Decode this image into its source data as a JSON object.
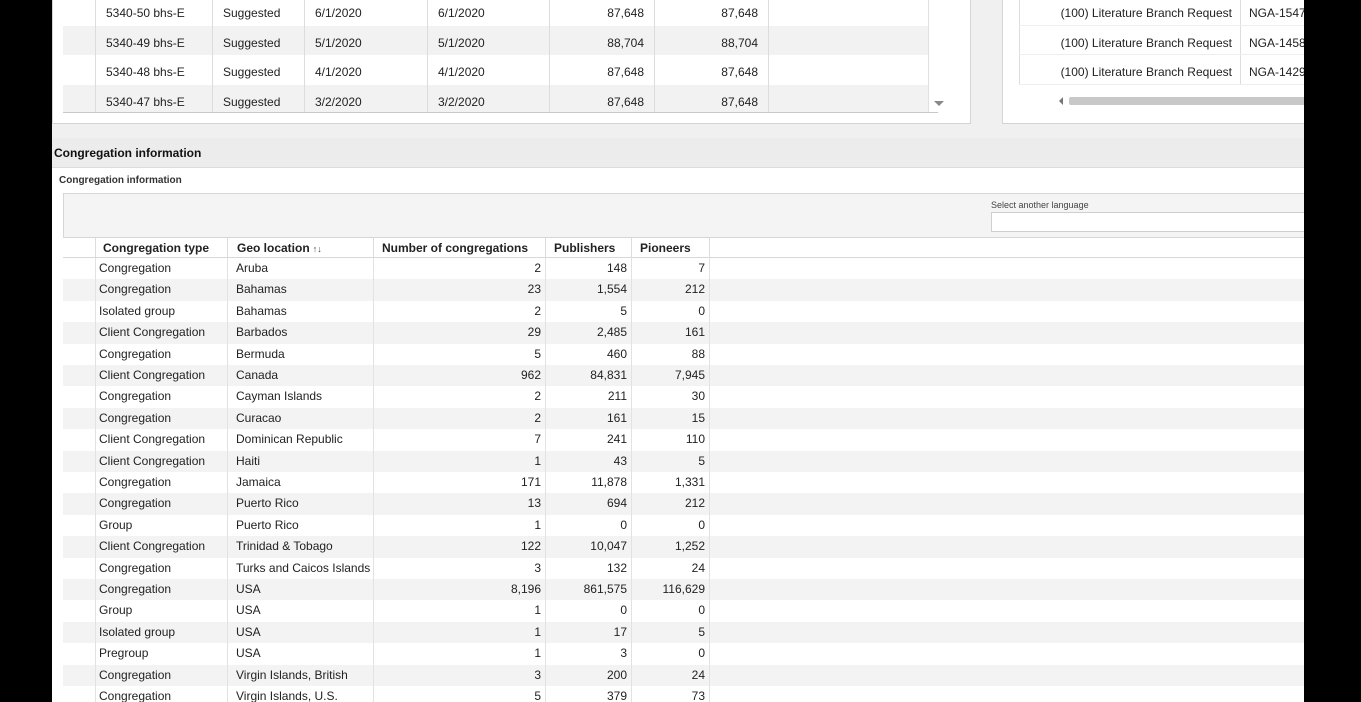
{
  "top_grid": {
    "rows": [
      {
        "item": "5340-50 bhs-E",
        "status": "Suggested",
        "date1": "6/1/2020",
        "date2": "6/1/2020",
        "qty1": "87,648",
        "qty2": "87,648"
      },
      {
        "item": "5340-49 bhs-E",
        "status": "Suggested",
        "date1": "5/1/2020",
        "date2": "5/1/2020",
        "qty1": "88,704",
        "qty2": "88,704"
      },
      {
        "item": "5340-48 bhs-E",
        "status": "Suggested",
        "date1": "4/1/2020",
        "date2": "4/1/2020",
        "qty1": "87,648",
        "qty2": "87,648"
      },
      {
        "item": "5340-47 bhs-E",
        "status": "Suggested",
        "date1": "3/2/2020",
        "date2": "3/2/2020",
        "qty1": "87,648",
        "qty2": "87,648"
      }
    ]
  },
  "right_grid": {
    "rows": [
      {
        "type": "(100) Literature Branch Request",
        "ref": "NGA-1547"
      },
      {
        "type": "(100) Literature Branch Request",
        "ref": "NGA-1458"
      },
      {
        "type": "(100) Literature Branch Request",
        "ref": "NGA-1429"
      }
    ]
  },
  "section": {
    "title": "Congregation information",
    "subtitle": "Congregation information",
    "language_label": "Select another language",
    "language_value": ""
  },
  "table": {
    "headers": {
      "type": "Congregation type",
      "geo": "Geo location",
      "congregations": "Number of congregations",
      "publishers": "Publishers",
      "pioneers": "Pioneers"
    },
    "geo_sort_icon": "↑↓",
    "rows": [
      {
        "type": "Congregation",
        "geo": "Aruba",
        "congregations": "2",
        "publishers": "148",
        "pioneers": "7"
      },
      {
        "type": "Congregation",
        "geo": "Bahamas",
        "congregations": "23",
        "publishers": "1,554",
        "pioneers": "212"
      },
      {
        "type": "Isolated group",
        "geo": "Bahamas",
        "congregations": "2",
        "publishers": "5",
        "pioneers": "0"
      },
      {
        "type": "Client Congregation",
        "geo": "Barbados",
        "congregations": "29",
        "publishers": "2,485",
        "pioneers": "161"
      },
      {
        "type": "Congregation",
        "geo": "Bermuda",
        "congregations": "5",
        "publishers": "460",
        "pioneers": "88"
      },
      {
        "type": "Client Congregation",
        "geo": "Canada",
        "congregations": "962",
        "publishers": "84,831",
        "pioneers": "7,945"
      },
      {
        "type": "Congregation",
        "geo": "Cayman Islands",
        "congregations": "2",
        "publishers": "211",
        "pioneers": "30"
      },
      {
        "type": "Congregation",
        "geo": "Curacao",
        "congregations": "2",
        "publishers": "161",
        "pioneers": "15"
      },
      {
        "type": "Client Congregation",
        "geo": "Dominican Republic",
        "congregations": "7",
        "publishers": "241",
        "pioneers": "110"
      },
      {
        "type": "Client Congregation",
        "geo": "Haiti",
        "congregations": "1",
        "publishers": "43",
        "pioneers": "5"
      },
      {
        "type": "Congregation",
        "geo": "Jamaica",
        "congregations": "171",
        "publishers": "11,878",
        "pioneers": "1,331"
      },
      {
        "type": "Congregation",
        "geo": "Puerto Rico",
        "congregations": "13",
        "publishers": "694",
        "pioneers": "212"
      },
      {
        "type": "Group",
        "geo": "Puerto Rico",
        "congregations": "1",
        "publishers": "0",
        "pioneers": "0"
      },
      {
        "type": "Client Congregation",
        "geo": "Trinidad & Tobago",
        "congregations": "122",
        "publishers": "10,047",
        "pioneers": "1,252"
      },
      {
        "type": "Congregation",
        "geo": "Turks and Caicos Islands",
        "congregations": "3",
        "publishers": "132",
        "pioneers": "24"
      },
      {
        "type": "Congregation",
        "geo": "USA",
        "congregations": "8,196",
        "publishers": "861,575",
        "pioneers": "116,629"
      },
      {
        "type": "Group",
        "geo": "USA",
        "congregations": "1",
        "publishers": "0",
        "pioneers": "0"
      },
      {
        "type": "Isolated group",
        "geo": "USA",
        "congregations": "1",
        "publishers": "17",
        "pioneers": "5"
      },
      {
        "type": "Pregroup",
        "geo": "USA",
        "congregations": "1",
        "publishers": "3",
        "pioneers": "0"
      },
      {
        "type": "Congregation",
        "geo": "Virgin Islands, British",
        "congregations": "3",
        "publishers": "200",
        "pioneers": "24"
      },
      {
        "type": "Congregation",
        "geo": "Virgin Islands, U.S.",
        "congregations": "5",
        "publishers": "379",
        "pioneers": "73"
      }
    ]
  }
}
